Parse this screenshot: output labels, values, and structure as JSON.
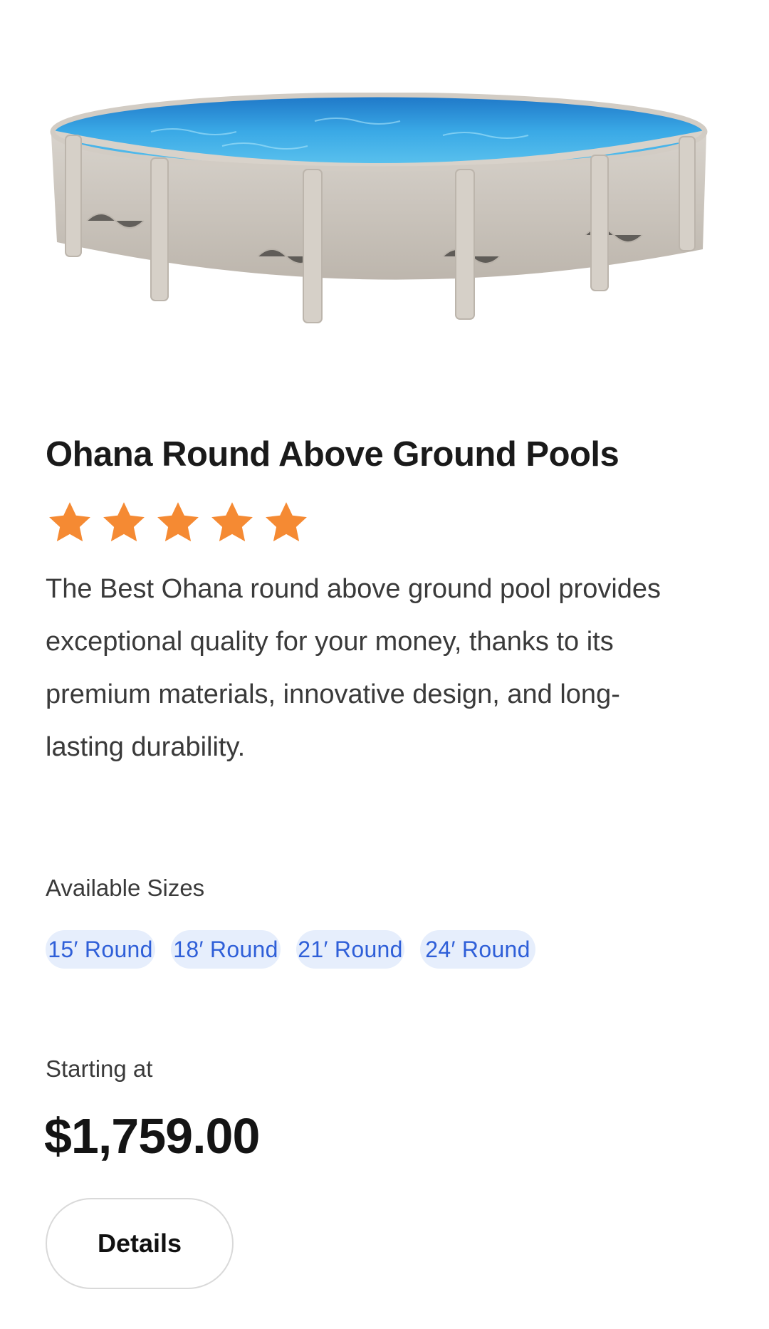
{
  "product": {
    "image_alt": "Ohana round above ground pool",
    "title": "Ohana Round Above Ground Pools",
    "rating": 5,
    "rating_max": 5,
    "star_color": "#f58a33",
    "description": "The Best Ohana round above ground pool provides exceptional quality for your money, thanks to its premium materials, innovative design, and long-lasting durability."
  },
  "sizes": {
    "label": "Available Sizes",
    "options": [
      "15′ Round",
      "18′ Round",
      "21′ Round",
      "24′ Round"
    ]
  },
  "pricing": {
    "label": "Starting at",
    "price": "$1,759.00"
  },
  "actions": {
    "details_label": "Details"
  },
  "colors": {
    "chip_bg": "#e6eefc",
    "chip_text": "#2f5fd8",
    "water": "#2f9fe0",
    "wall": "#cfc9c1"
  }
}
